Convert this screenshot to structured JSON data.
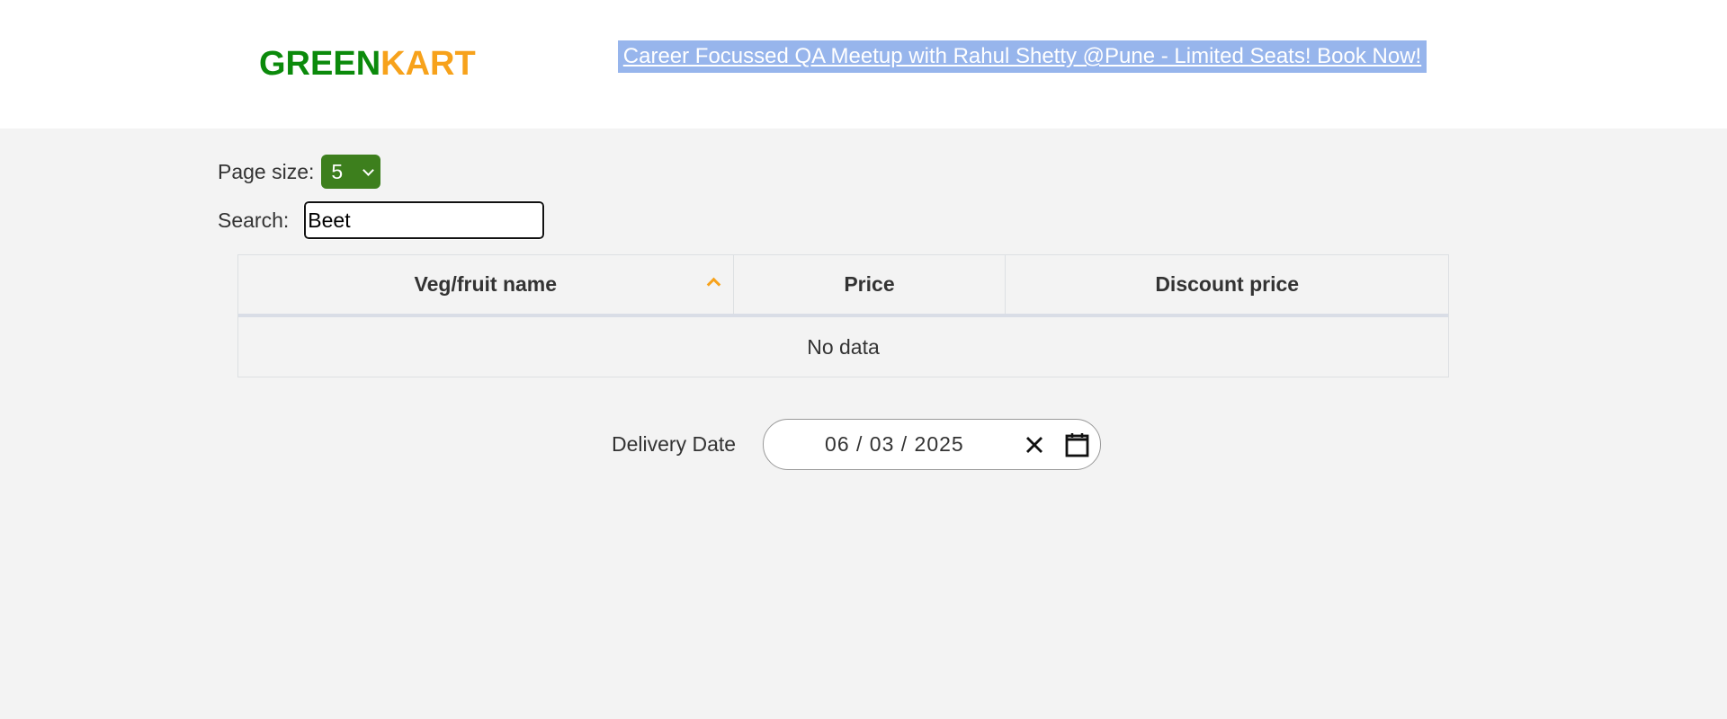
{
  "header": {
    "logo_green": "GREEN",
    "logo_kart": "KART",
    "promo_link": "Career Focussed QA Meetup with Rahul Shetty @Pune - Limited Seats! Book Now!"
  },
  "controls": {
    "page_size_label": "Page size:",
    "page_size_value": "5",
    "search_label": "Search:",
    "search_value": "Beet"
  },
  "table": {
    "columns": [
      "Veg/fruit name",
      "Price",
      "Discount price"
    ],
    "sorted_column": "Veg/fruit name",
    "sort_direction": "ascending",
    "empty_message": "No data"
  },
  "delivery": {
    "label": "Delivery Date",
    "date_value": "06 / 03 / 2025"
  },
  "colors": {
    "logo_green": "#0b8a0b",
    "logo_orange": "#f7a21b",
    "promo_bg": "#97b5ec",
    "select_bg": "#3d7f1d"
  },
  "icons": {
    "sort": "chevron-up-icon",
    "select": "chevron-down-icon",
    "clear": "close-icon",
    "calendar": "calendar-icon"
  }
}
